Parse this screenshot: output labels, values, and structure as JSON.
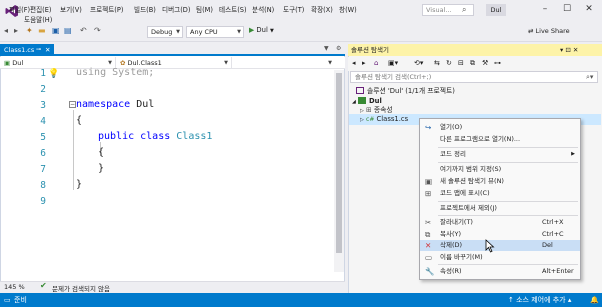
{
  "menu": {
    "items_row1": [
      "파일(F)",
      "편집(E)",
      "보기(V)",
      "프로젝트(P)",
      "빌드(B)",
      "디버그(D)",
      "팀(M)",
      "테스트(S)",
      "분석(N)",
      "도구(T)",
      "확장(X)",
      "창(W)"
    ],
    "items_row2": [
      "도움말(H)"
    ],
    "search_placeholder": "Visual...",
    "solution_name": "Dul"
  },
  "toolbar": {
    "config": "Debug",
    "platform": "Any CPU",
    "run_label": "Dul",
    "live_share": "Live Share"
  },
  "editor": {
    "tab_title": "Class1.cs",
    "nav_project": "Dul",
    "nav_class": "Dul.Class1",
    "nav_member": "",
    "line_numbers": [
      "1",
      "2",
      "3",
      "4",
      "5",
      "6",
      "7",
      "8",
      "9"
    ],
    "code": {
      "l1_kw": "using",
      "l1_rest": " System;",
      "l3_kw": "namespace",
      "l3_rest": " Dul",
      "l4": "{",
      "l5_kw": "public class",
      "l5_type": "Class1",
      "l6": "{",
      "l7": "}",
      "l8": "}"
    },
    "zoom": "145 %",
    "issues": "문제가 검색되지 않음"
  },
  "solution_explorer": {
    "title": "솔루션 탐색기",
    "title_buttons": "▾ ⊡ ✕",
    "search_placeholder": "솔루션 탐색기 검색(Ctrl+;)",
    "tree": {
      "solution": "솔루션 'Dul' (1/1개 프로젝트)",
      "project": "Dul",
      "dependencies": "종속성",
      "file": "Class1.cs"
    }
  },
  "context_menu": {
    "items": [
      {
        "label": "열기(O)",
        "shortcut": ""
      },
      {
        "label": "다른 프로그램으로 열기(N)...",
        "shortcut": ""
      },
      {
        "label": "코드 정리",
        "shortcut": ""
      },
      {
        "label": "여기까지 범위 지정(S)",
        "shortcut": ""
      },
      {
        "label": "새 솔루션 탐색기 뷰(N)",
        "shortcut": ""
      },
      {
        "label": "코드 맵에 표시(C)",
        "shortcut": ""
      },
      {
        "label": "프로젝트에서 제외(J)",
        "shortcut": ""
      },
      {
        "label": "잘라내기(T)",
        "shortcut": "Ctrl+X"
      },
      {
        "label": "복사(Y)",
        "shortcut": "Ctrl+C"
      },
      {
        "label": "삭제(D)",
        "shortcut": "Del"
      },
      {
        "label": "이름 바꾸기(M)",
        "shortcut": ""
      },
      {
        "label": "속성(R)",
        "shortcut": "Alt+Enter"
      }
    ]
  },
  "statusbar": {
    "status": "준비",
    "source_control": "↑ 소스 제어에 추가 ▴"
  },
  "colors": {
    "accent": "#007acc",
    "panel_title": "#fdf3a8",
    "highlight": "#c9def5"
  }
}
